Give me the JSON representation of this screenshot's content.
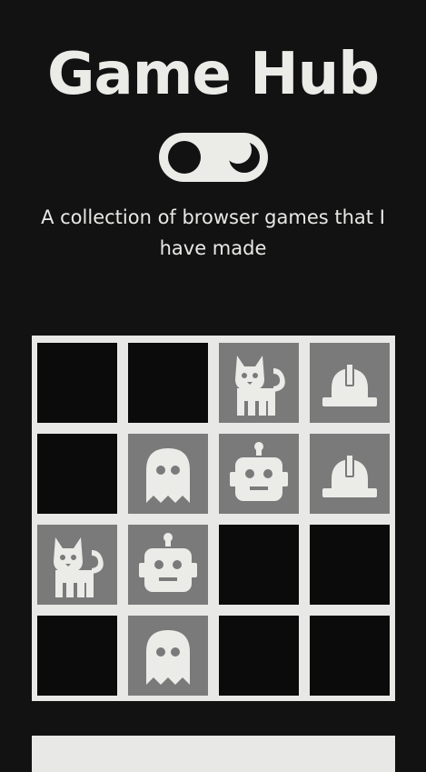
{
  "header": {
    "title": "Game Hub",
    "subtitle": "A collection of browser games that I have made"
  },
  "theme_toggle": {
    "state": "dark",
    "icon": "moon-icon"
  },
  "colors": {
    "background": "#121212",
    "foreground": "#e8e8e6",
    "tile_hidden": "#0b0b0b",
    "tile_revealed": "#7a7a7a"
  },
  "board": {
    "rows": 4,
    "columns": 4,
    "tiles": [
      [
        "hidden",
        "hidden",
        "cat",
        "hardhat"
      ],
      [
        "hidden",
        "ghost",
        "robot",
        "hardhat"
      ],
      [
        "cat",
        "robot",
        "hidden",
        "hidden"
      ],
      [
        "hidden",
        "ghost",
        "hidden",
        "hidden"
      ]
    ]
  }
}
